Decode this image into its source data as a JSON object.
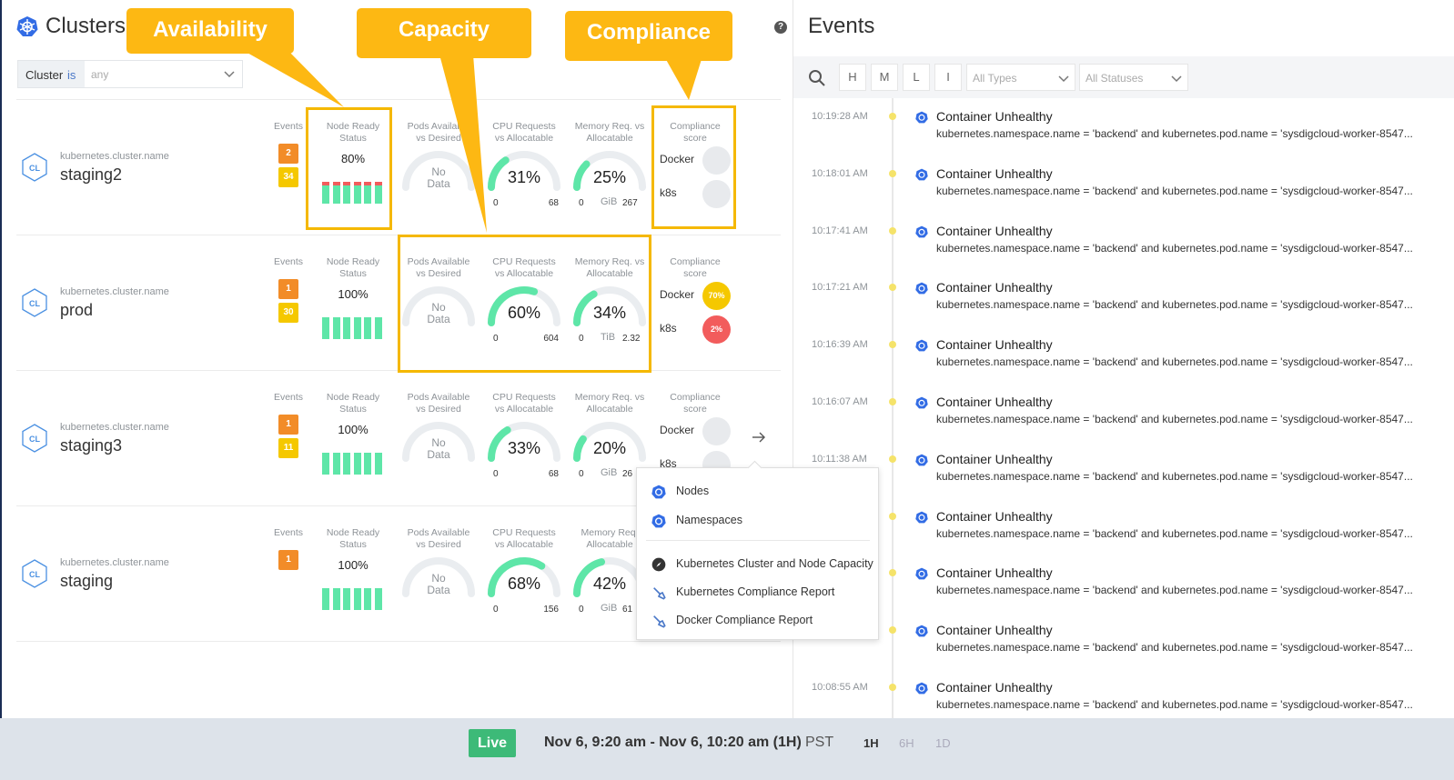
{
  "clusters_panel": {
    "title": "Clusters",
    "help": "?",
    "filter": {
      "field": "Cluster",
      "operator": "is",
      "placeholder": "any"
    },
    "rows": [
      {
        "field_label": "kubernetes.cluster.name",
        "name": "staging2",
        "badge": "CL",
        "events_label": "Events",
        "events": [
          "2",
          "34"
        ],
        "node_label_1": "Node Ready",
        "node_label_2": "Status",
        "node_value": "80%",
        "pods_label_1": "Pods Available",
        "pods_label_2": "vs Desired",
        "pods_value": "No Data",
        "cpu_label_1": "CPU Requests",
        "cpu_label_2": "vs Allocatable",
        "cpu_value": "31%",
        "cpu_min": "0",
        "cpu_max": "68",
        "cpu_pct": 31,
        "mem_label_1": "Memory Req. vs",
        "mem_label_2": "Allocatable",
        "mem_value": "25%",
        "mem_min": "0",
        "mem_unit": "GiB",
        "mem_max": "267",
        "mem_pct": 25,
        "comp_label_1": "Compliance",
        "comp_label_2": "score",
        "docker": "Docker",
        "docker_score": "",
        "k8s": "k8s",
        "k8s_score": ""
      },
      {
        "field_label": "kubernetes.cluster.name",
        "name": "prod",
        "badge": "CL",
        "events_label": "Events",
        "events": [
          "1",
          "30"
        ],
        "node_label_1": "Node Ready",
        "node_label_2": "Status",
        "node_value": "100%",
        "pods_label_1": "Pods Available",
        "pods_label_2": "vs Desired",
        "pods_value": "No Data",
        "cpu_label_1": "CPU Requests",
        "cpu_label_2": "vs Allocatable",
        "cpu_value": "60%",
        "cpu_min": "0",
        "cpu_max": "604",
        "cpu_pct": 60,
        "mem_label_1": "Memory Req. vs",
        "mem_label_2": "Allocatable",
        "mem_value": "34%",
        "mem_min": "0",
        "mem_unit": "TiB",
        "mem_max": "2.32",
        "mem_pct": 34,
        "comp_label_1": "Compliance",
        "comp_label_2": "score",
        "docker": "Docker",
        "docker_score": "70%",
        "k8s": "k8s",
        "k8s_score": "2%"
      },
      {
        "field_label": "kubernetes.cluster.name",
        "name": "staging3",
        "badge": "CL",
        "events_label": "Events",
        "events": [
          "1",
          "11"
        ],
        "node_label_1": "Node Ready",
        "node_label_2": "Status",
        "node_value": "100%",
        "pods_label_1": "Pods Available",
        "pods_label_2": "vs Desired",
        "pods_value": "No Data",
        "cpu_label_1": "CPU Requests",
        "cpu_label_2": "vs Allocatable",
        "cpu_value": "33%",
        "cpu_min": "0",
        "cpu_max": "68",
        "cpu_pct": 33,
        "mem_label_1": "Memory Req. vs",
        "mem_label_2": "Allocatable",
        "mem_value": "20%",
        "mem_min": "0",
        "mem_unit": "GiB",
        "mem_max": "26",
        "mem_pct": 20,
        "comp_label_1": "Compliance",
        "comp_label_2": "score",
        "docker": "Docker",
        "docker_score": "",
        "k8s": "k8s",
        "k8s_score": ""
      },
      {
        "field_label": "kubernetes.cluster.name",
        "name": "staging",
        "badge": "CL",
        "events_label": "Events",
        "events": [
          "1"
        ],
        "node_label_1": "Node Ready",
        "node_label_2": "Status",
        "node_value": "100%",
        "pods_label_1": "Pods Available",
        "pods_label_2": "vs Desired",
        "pods_value": "No Data",
        "cpu_label_1": "CPU Requests",
        "cpu_label_2": "vs Allocatable",
        "cpu_value": "68%",
        "cpu_min": "0",
        "cpu_max": "156",
        "cpu_pct": 68,
        "mem_label_1": "Memory Req.",
        "mem_label_2": "Allocatable",
        "mem_value": "42%",
        "mem_min": "0",
        "mem_unit": "GiB",
        "mem_max": "61",
        "mem_pct": 42,
        "comp_label_1": "",
        "comp_label_2": "",
        "docker": "",
        "docker_score": "",
        "k8s": "",
        "k8s_score": ""
      }
    ]
  },
  "callouts": {
    "availability": "Availability",
    "capacity": "Capacity",
    "compliance": "Compliance"
  },
  "context_menu": {
    "items": [
      "Nodes",
      "Namespaces",
      "Kubernetes Cluster and Node Capacity",
      "Kubernetes Compliance Report",
      "Docker Compliance Report"
    ]
  },
  "events_panel": {
    "title": "Events",
    "severity": [
      "H",
      "M",
      "L",
      "I"
    ],
    "type_filter": "All Types",
    "status_filter": "All Statuses",
    "events": [
      {
        "time": "10:19:28 AM",
        "title": "Container Unhealthy",
        "detail": "kubernetes.namespace.name = 'backend' and kubernetes.pod.name = 'sysdigcloud-worker-8547..."
      },
      {
        "time": "10:18:01 AM",
        "title": "Container Unhealthy",
        "detail": "kubernetes.namespace.name = 'backend' and kubernetes.pod.name = 'sysdigcloud-worker-8547..."
      },
      {
        "time": "10:17:41 AM",
        "title": "Container Unhealthy",
        "detail": "kubernetes.namespace.name = 'backend' and kubernetes.pod.name = 'sysdigcloud-worker-8547..."
      },
      {
        "time": "10:17:21 AM",
        "title": "Container Unhealthy",
        "detail": "kubernetes.namespace.name = 'backend' and kubernetes.pod.name = 'sysdigcloud-worker-8547..."
      },
      {
        "time": "10:16:39 AM",
        "title": "Container Unhealthy",
        "detail": "kubernetes.namespace.name = 'backend' and kubernetes.pod.name = 'sysdigcloud-worker-8547..."
      },
      {
        "time": "10:16:07 AM",
        "title": "Container Unhealthy",
        "detail": "kubernetes.namespace.name = 'backend' and kubernetes.pod.name = 'sysdigcloud-worker-8547..."
      },
      {
        "time": "10:11:38 AM",
        "title": "Container Unhealthy",
        "detail": "kubernetes.namespace.name = 'backend' and kubernetes.pod.name = 'sysdigcloud-worker-8547..."
      },
      {
        "time": "",
        "title": "Container Unhealthy",
        "detail": "kubernetes.namespace.name = 'backend' and kubernetes.pod.name = 'sysdigcloud-worker-8547..."
      },
      {
        "time": "",
        "title": "Container Unhealthy",
        "detail": "kubernetes.namespace.name = 'backend' and kubernetes.pod.name = 'sysdigcloud-worker-8547..."
      },
      {
        "time": "",
        "title": "Container Unhealthy",
        "detail": "kubernetes.namespace.name = 'backend' and kubernetes.pod.name = 'sysdigcloud-worker-8547..."
      },
      {
        "time": "10:08:55 AM",
        "title": "Container Unhealthy",
        "detail": "kubernetes.namespace.name = 'backend' and kubernetes.pod.name = 'sysdigcloud-worker-8547..."
      }
    ]
  },
  "footer": {
    "live": "Live",
    "range": "Nov 6, 9:20 am - Nov 6, 10:20 am (1H)",
    "tz": "PST",
    "ranges": [
      "1H",
      "6H",
      "1D"
    ]
  },
  "colors": {
    "green": "#5ee6a8",
    "red": "#f25c5c",
    "orange": "#f28c28",
    "yellow": "#f5c800",
    "callout": "#fdb813",
    "blue": "#3d6fd8",
    "live": "#3dba78"
  }
}
